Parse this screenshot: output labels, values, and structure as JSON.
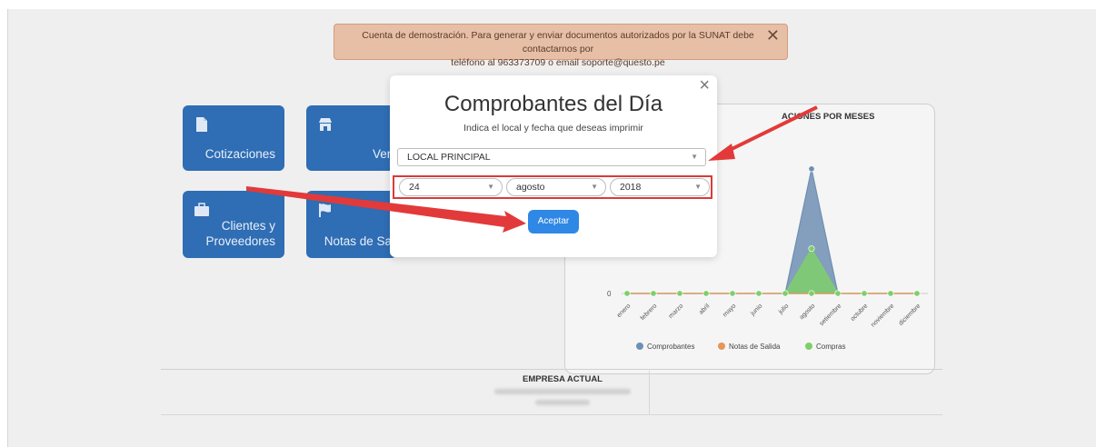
{
  "banner": {
    "line1": "Cuenta de demostración. Para generar y enviar documentos autorizados por la SUNAT debe contactarnos por",
    "line2": "teléfono al 963373709 o email soporte@questo.pe",
    "close": "✕"
  },
  "tiles": {
    "cotizaciones": "Cotizaciones",
    "ventas": "Vent",
    "clientes_line1": "Clientes y",
    "clientes_line2": "Proveedores",
    "notas": "Notas de Sali"
  },
  "chart_data": {
    "type": "area",
    "title": "ACIONES POR MESES",
    "categories": [
      "enero",
      "febrero",
      "marzo",
      "abril",
      "mayo",
      "junio",
      "julio",
      "agosto",
      "setiembre",
      "octubre",
      "noviembre",
      "diciembre"
    ],
    "ytick_label": "0",
    "series": [
      {
        "name": "Comprobantes",
        "color": "#6f8fb3",
        "values": [
          0,
          0,
          0,
          0,
          0,
          0,
          0,
          10,
          0,
          0,
          0,
          0
        ]
      },
      {
        "name": "Notas de Salida",
        "color": "#e8955a",
        "values": [
          0,
          0,
          0,
          0,
          0,
          0,
          0,
          0,
          0,
          0,
          0,
          0
        ]
      },
      {
        "name": "Compras",
        "color": "#7fcf6b",
        "values": [
          0,
          0,
          0,
          0,
          0,
          0,
          0,
          3.6,
          0,
          0,
          0,
          0
        ]
      }
    ],
    "ylim": [
      0,
      10.5
    ],
    "legend_position": "bottom",
    "grid": false
  },
  "footer": {
    "empresa_label": "EMPRESA ACTUAL"
  },
  "modal": {
    "close": "×",
    "title": "Comprobantes del Día",
    "subtitle": "Indica el local y fecha que deseas imprimir",
    "local": "LOCAL PRINCIPAL",
    "day": "24",
    "month": "agosto",
    "year": "2018",
    "accept": "Aceptar"
  },
  "colors": {
    "tile": "#2f6db4",
    "accept_button": "#2f87e6",
    "highlight": "#d93b3b",
    "banner_bg": "#e7bfa6"
  }
}
